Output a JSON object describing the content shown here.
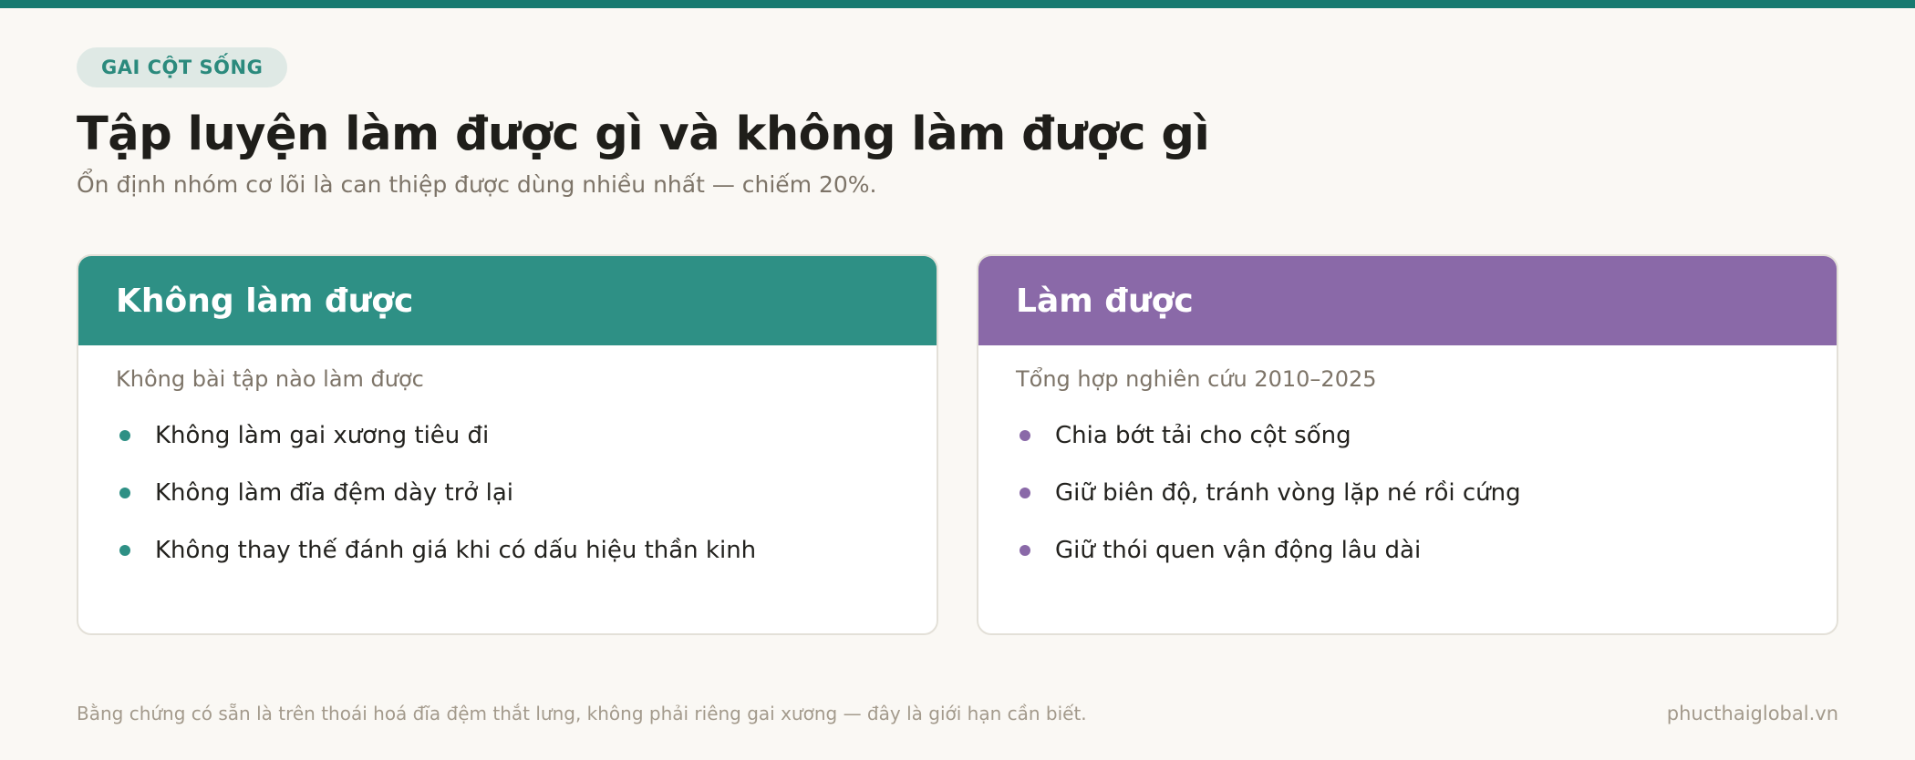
{
  "badge": "GAI CỘT SỐNG",
  "title": "Tập luyện làm được gì và không làm được gì",
  "subtitle": "Ổn định nhóm cơ lõi là can thiệp được dùng nhiều nhất — chiếm 20%.",
  "colors": {
    "accent_bar": "#177a70",
    "teal": "#2e9085",
    "purple": "#8a69a8"
  },
  "cards": [
    {
      "header": "Không làm được",
      "subtitle": "Không bài tập nào làm được",
      "items": [
        "Không làm gai xương tiêu đi",
        "Không làm đĩa đệm dày trở lại",
        "Không thay thế đánh giá khi có dấu hiệu thần kinh"
      ]
    },
    {
      "header": "Làm được",
      "subtitle": "Tổng hợp nghiên cứu 2010–2025",
      "items": [
        "Chia bớt tải cho cột sống",
        "Giữ biên độ, tránh vòng lặp né rồi cứng",
        "Giữ thói quen vận động lâu dài"
      ]
    }
  ],
  "footer": {
    "note": "Bằng chứng có sẵn là trên thoái hoá đĩa đệm thắt lưng, không phải riêng gai xương — đây là giới hạn cần biết.",
    "site": "phucthaiglobal.vn"
  }
}
